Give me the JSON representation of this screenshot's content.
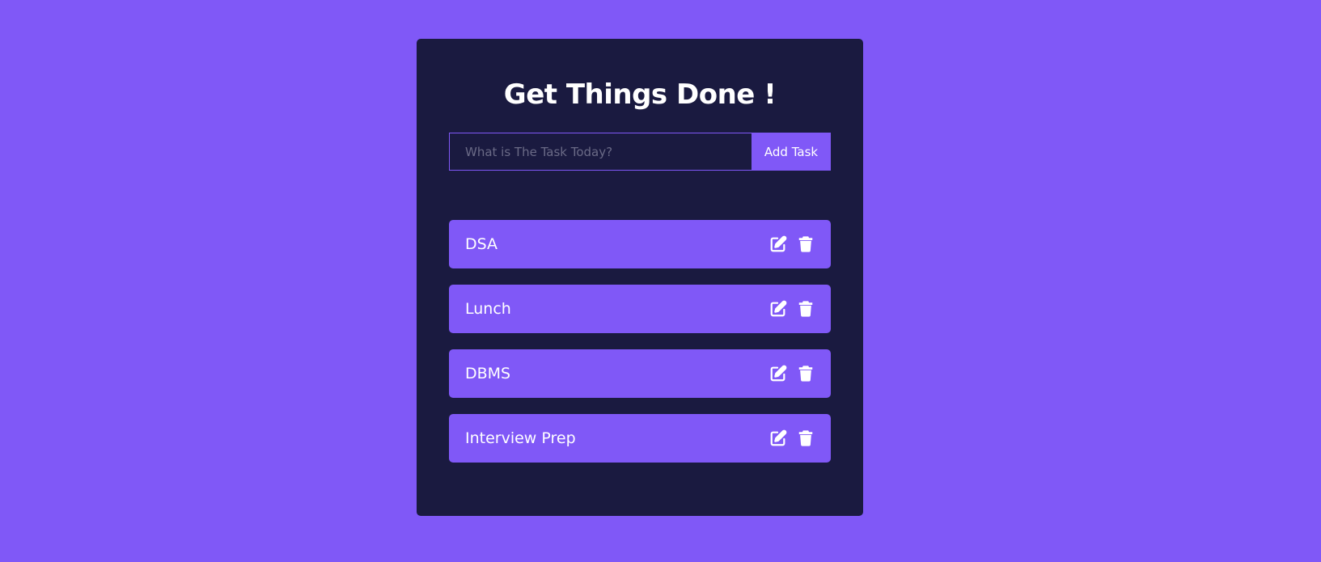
{
  "app": {
    "title": "Get Things Done !"
  },
  "form": {
    "input_value": "",
    "input_placeholder": "What is The Task Today?",
    "add_button_label": "Add Task"
  },
  "todos": [
    {
      "text": "DSA",
      "edit_icon": "edit-icon",
      "delete_icon": "trash-icon"
    },
    {
      "text": "Lunch",
      "edit_icon": "edit-icon",
      "delete_icon": "trash-icon"
    },
    {
      "text": "DBMS",
      "edit_icon": "edit-icon",
      "delete_icon": "trash-icon"
    },
    {
      "text": "Interview Prep",
      "edit_icon": "edit-icon",
      "delete_icon": "trash-icon"
    }
  ],
  "colors": {
    "background": "#8058f7",
    "card": "#1a1a40",
    "accent": "#8058f7",
    "text": "#ffffff",
    "placeholder": "#6a6a86"
  }
}
